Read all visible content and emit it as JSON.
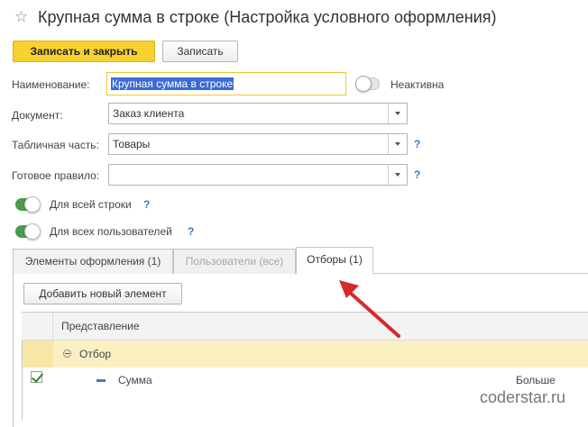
{
  "window": {
    "title": "Крупная сумма в строке (Настройка условного оформления)"
  },
  "toolbar": {
    "save_close_label": "Записать и закрыть",
    "save_label": "Записать"
  },
  "form": {
    "name_label": "Наименование:",
    "name_value": "Крупная сумма в строке",
    "inactive_label": "Неактивна",
    "document_label": "Документ:",
    "document_value": "Заказ клиента",
    "table_part_label": "Табличная часть:",
    "table_part_value": "Товары",
    "ready_rule_label": "Готовое правило:",
    "ready_rule_value": "",
    "whole_row_label": "Для всей строки",
    "all_users_label": "Для всех пользователей",
    "help_symbol": "?"
  },
  "tabs": [
    {
      "label": "Элементы оформления (1)",
      "state": "normal"
    },
    {
      "label": "Пользователи (все)",
      "state": "disabled"
    },
    {
      "label": "Отборы (1)",
      "state": "active"
    }
  ],
  "filters": {
    "add_button_label": "Добавить новый элемент",
    "column_header": "Представление",
    "group_row_label": "Отбор",
    "item_row": {
      "field": "Сумма",
      "comparison": "Больше"
    }
  },
  "watermark": "coderstar.ru",
  "colors": {
    "primary_button": "#f6d12f",
    "toggle_on": "#4d9a4d",
    "selected_row": "#fbf0c2",
    "arrow": "#d42a2a",
    "help": "#3a76c8"
  },
  "icons": {
    "favorite": "star-icon",
    "dropdown": "chevron-down-icon",
    "collapse": "collapse-circle-icon",
    "field_type": "minus-icon",
    "checkbox": "checkbox-checked-icon"
  }
}
